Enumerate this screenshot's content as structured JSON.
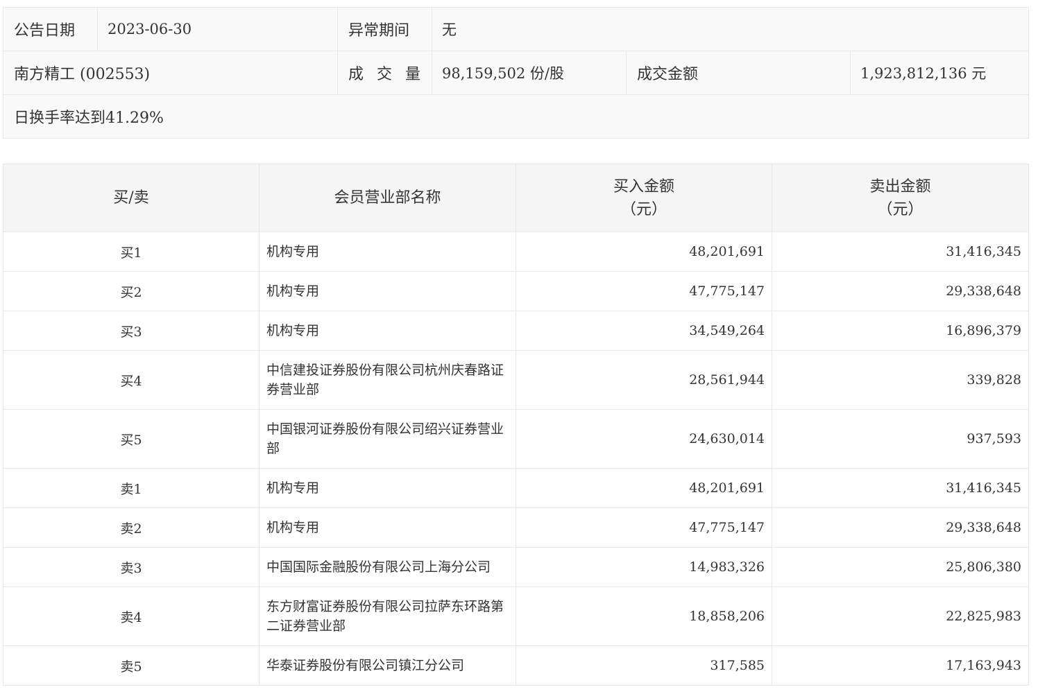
{
  "summary": {
    "announce_date_label": "公告日期",
    "announce_date_value": "2023-06-30",
    "abnormal_period_label": "异常期间",
    "abnormal_period_value": "无",
    "stock_name": "南方精工 (002553)",
    "volume_label": "成 交 量",
    "volume_value": "98,159,502 份/股",
    "amount_label": "成交金额",
    "amount_value": "1,923,812,136 元",
    "reason": "日换手率达到41.29%"
  },
  "detail": {
    "headers": {
      "side": "买/卖",
      "member": "会员营业部名称",
      "buy_amount": "买入金额",
      "buy_unit": "（元）",
      "sell_amount": "卖出金额",
      "sell_unit": "（元）"
    },
    "rows": [
      {
        "side": "买1",
        "name": "机构专用",
        "buy": "48,201,691",
        "sell": "31,416,345"
      },
      {
        "side": "买2",
        "name": "机构专用",
        "buy": "47,775,147",
        "sell": "29,338,648"
      },
      {
        "side": "买3",
        "name": "机构专用",
        "buy": "34,549,264",
        "sell": "16,896,379"
      },
      {
        "side": "买4",
        "name": "中信建投证券股份有限公司杭州庆春路证券营业部",
        "buy": "28,561,944",
        "sell": "339,828"
      },
      {
        "side": "买5",
        "name": "中国银河证券股份有限公司绍兴证券营业部",
        "buy": "24,630,014",
        "sell": "937,593"
      },
      {
        "side": "卖1",
        "name": "机构专用",
        "buy": "48,201,691",
        "sell": "31,416,345"
      },
      {
        "side": "卖2",
        "name": "机构专用",
        "buy": "47,775,147",
        "sell": "29,338,648"
      },
      {
        "side": "卖3",
        "name": "中国国际金融股份有限公司上海分公司",
        "buy": "14,983,326",
        "sell": "25,806,380"
      },
      {
        "side": "卖4",
        "name": "东方财富证券股份有限公司拉萨东环路第二证券营业部",
        "buy": "18,858,206",
        "sell": "22,825,983"
      },
      {
        "side": "卖5",
        "name": "华泰证券股份有限公司镇江分公司",
        "buy": "317,585",
        "sell": "17,163,943"
      }
    ]
  }
}
